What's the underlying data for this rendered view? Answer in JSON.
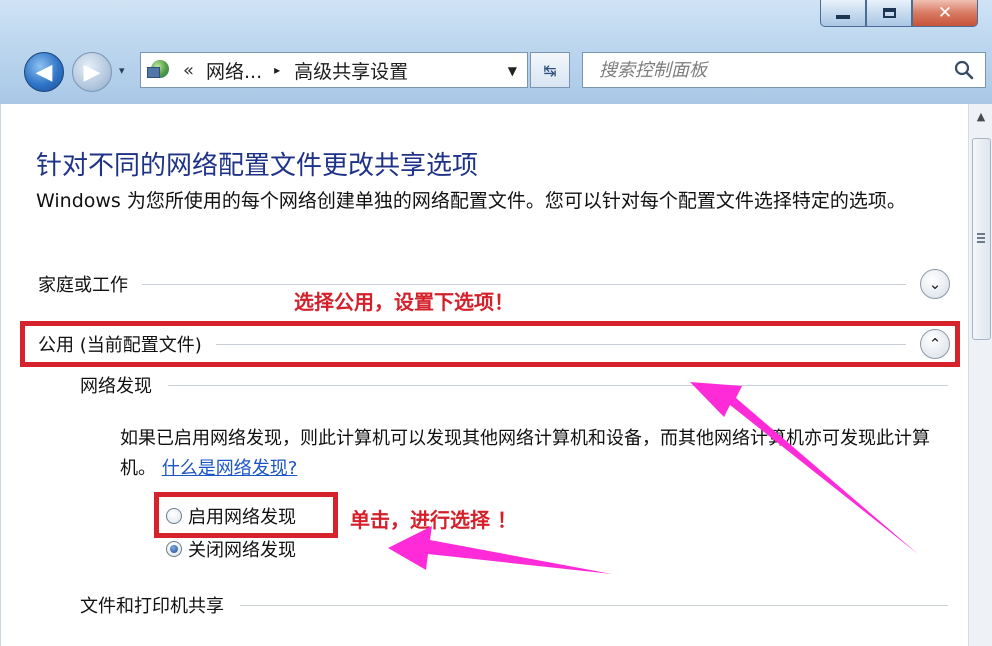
{
  "window": {
    "minimize_label": "",
    "maximize_label": "",
    "close_label": "✕"
  },
  "nav": {
    "back_glyph": "◀",
    "forward_glyph": "▶",
    "history_dropdown_glyph": "▾"
  },
  "address": {
    "overflow_glyph": "«",
    "segments": [
      "网络...",
      "高级共享设置"
    ],
    "separator_glyph": "▸",
    "dropdown_glyph": "▼"
  },
  "refresh_glyph": "↹",
  "search": {
    "placeholder": "搜索控制面板",
    "value": ""
  },
  "page": {
    "title": "针对不同的网络配置文件更改共享选项",
    "description": "Windows 为您所使用的每个网络创建单独的网络配置文件。您可以针对每个配置文件选择特定的选项。"
  },
  "profiles": [
    {
      "label": "家庭或工作",
      "expanded": false,
      "expander_glyph": "⌄"
    },
    {
      "label": "公用 (当前配置文件)",
      "expanded": true,
      "expander_glyph": "⌃"
    }
  ],
  "network_discovery": {
    "heading": "网络发现",
    "info": "如果已启用网络发现，则此计算机可以发现其他网络计算机和设备，而其他网络计算机亦可发现此计算机。",
    "help_link": "什么是网络发现?",
    "options": [
      {
        "label": "启用网络发现",
        "checked": false
      },
      {
        "label": "关闭网络发现",
        "checked": true
      }
    ]
  },
  "file_printer_sharing": {
    "heading": "文件和打印机共享"
  },
  "annotations": {
    "select_public": "选择公用，设置下选项！",
    "click_select": "单击，进行选择 ！",
    "color": "#d6222a",
    "arrow_color": "#ff2bd9"
  },
  "scrollbar": {
    "up_glyph": "▲"
  }
}
